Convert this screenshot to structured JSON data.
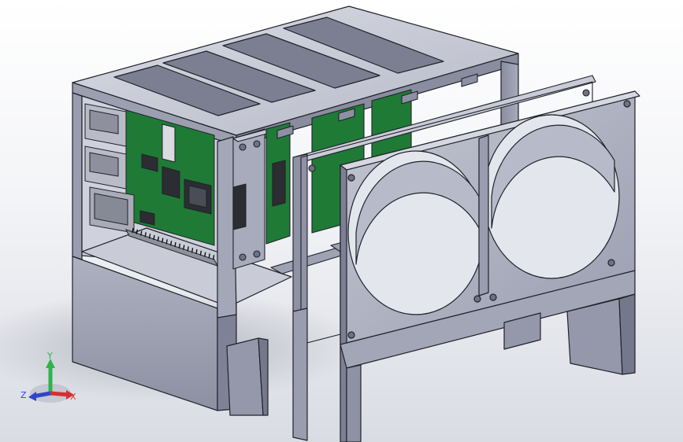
{
  "viewport": {
    "colors": {
      "background_top": "#ffffff",
      "background_bottom": "#d9dce3",
      "metal_light": "#c8cad6",
      "metal_mid": "#9fa2b3",
      "metal_dark": "#6f7285",
      "pcb": "#1f7a36",
      "connector": "#b9bcc6",
      "edge": "#20222a"
    }
  },
  "triad": {
    "y_label": "Y",
    "x_label": "X",
    "z_label": "Z",
    "colors": {
      "x": "#d43131",
      "y": "#2fb34a",
      "z": "#2f45c9"
    }
  }
}
